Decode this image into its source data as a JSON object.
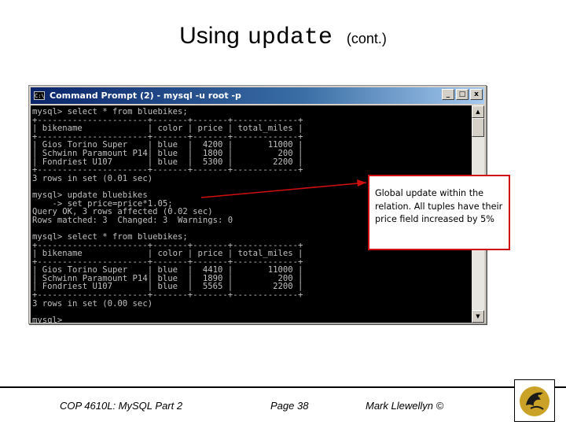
{
  "slide": {
    "title_word": "Using",
    "title_code": "update",
    "title_suffix": "(cont.)"
  },
  "window": {
    "title": "Command Prompt (2) - mysql -u root -p",
    "icon_text": "C:\\",
    "buttons": {
      "minimize": "_",
      "maximize": "□",
      "close": "x"
    }
  },
  "console": {
    "lines": [
      "mysql> select * from bluebikes;",
      "+----------------------+-------+-------+-------------+",
      "| bikename             | color | price | total_miles |",
      "+----------------------+-------+-------+-------------+",
      "| Gios Torino Super    | blue  |  4200 |       11000 |",
      "| Schwinn Paramount P14| blue  |  1800 |         200 |",
      "| Fondriest U107       | blue  |  5300 |        2200 |",
      "+----------------------+-------+-------+-------------+",
      "3 rows in set (0.01 sec)",
      "",
      "mysql> update bluebikes",
      "    -> set price=price*1.05;",
      "Query OK, 3 rows affected (0.02 sec)",
      "Rows matched: 3  Changed: 3  Warnings: 0",
      "",
      "mysql> select * from bluebikes;",
      "+----------------------+-------+-------+-------------+",
      "| bikename             | color | price | total_miles |",
      "+----------------------+-------+-------+-------------+",
      "| Gios Torino Super    | blue  |  4410 |       11000 |",
      "| Schwinn Paramount P14| blue  |  1890 |         200 |",
      "| Fondriest U107       | blue  |  5565 |        2200 |",
      "+----------------------+-------+-------+-------------+",
      "3 rows in set (0.00 sec)",
      "",
      "mysql>"
    ]
  },
  "callout": {
    "text": "Global update within the relation.  All tuples have their price field increased by 5%",
    "border_color": "#d01010"
  },
  "footer": {
    "course": "COP 4610L: MySQL Part 2",
    "page": "Page 38",
    "author": "Mark Llewellyn ©"
  },
  "icons": {
    "logo": "ucf-pegasus-logo",
    "scroll_up": "scroll-up-arrow-icon",
    "scroll_down": "scroll-down-arrow-icon"
  },
  "colors": {
    "titlebar_start": "#0a246a",
    "titlebar_end": "#a6caf0",
    "console_bg": "#000000",
    "console_fg": "#c0c0c0",
    "logo_gold": "#c9a227"
  }
}
